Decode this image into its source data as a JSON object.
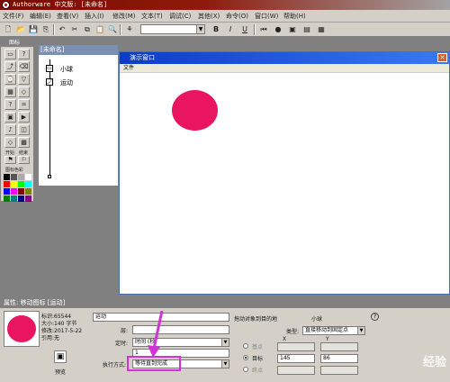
{
  "titlebar": {
    "title": "Authorware 中文版: [未命名]"
  },
  "menu": {
    "items": [
      "文件(F)",
      "编辑(E)",
      "查看(V)",
      "插入(I)",
      "修改(M)",
      "文本(T)",
      "调试(C)",
      "其他(X)",
      "命令(O)",
      "窗口(W)",
      "帮助(H)"
    ]
  },
  "toolbar": {
    "bold": "B",
    "italic": "I",
    "underline": "U"
  },
  "icon_palette": {
    "title": "图标",
    "start_label": "开始",
    "end_label": "结束",
    "color_label": "图标色彩",
    "swatch_colors": [
      "#000000",
      "#555555",
      "#aaaaaa",
      "#ffffff",
      "#ff0000",
      "#ffff00",
      "#00ff00",
      "#00ffff",
      "#0000ff",
      "#ff00ff",
      "#800000",
      "#808000",
      "#008000",
      "#008080",
      "#000080",
      "#800080"
    ]
  },
  "flow_window": {
    "title": "[未命名]",
    "icons": [
      {
        "label": "小球"
      },
      {
        "label": "运动"
      }
    ]
  },
  "presentation": {
    "title": "演示窗口",
    "menu_file": "文件",
    "close": "✕",
    "circle_color": "#ea1561"
  },
  "properties": {
    "title": "属性: 移动图标 [运动]",
    "info": {
      "id": "标识:65544",
      "size": "大小:140 字节",
      "modified": "修改:2017-5-22",
      "ref": "引用:无"
    },
    "preview_label": "预览",
    "name_value": "运动",
    "layer_label": "层:",
    "timing_label": "定时:",
    "timing_value": "时间 (秒)",
    "timing_number": "1",
    "exec_label": "执行方式:",
    "exec_value": "等待直到完成",
    "target_object_label": "拖动对象到目的地",
    "target_object_value": "小球",
    "type_label": "类型:",
    "type_value": "直接移动到固定点",
    "help": "?",
    "radio_base": "基点",
    "radio_target": "目标",
    "radio_end": "终点",
    "x_header": "X",
    "y_header": "Y",
    "target_x": "145",
    "target_y": "86"
  },
  "watermark": "经验"
}
